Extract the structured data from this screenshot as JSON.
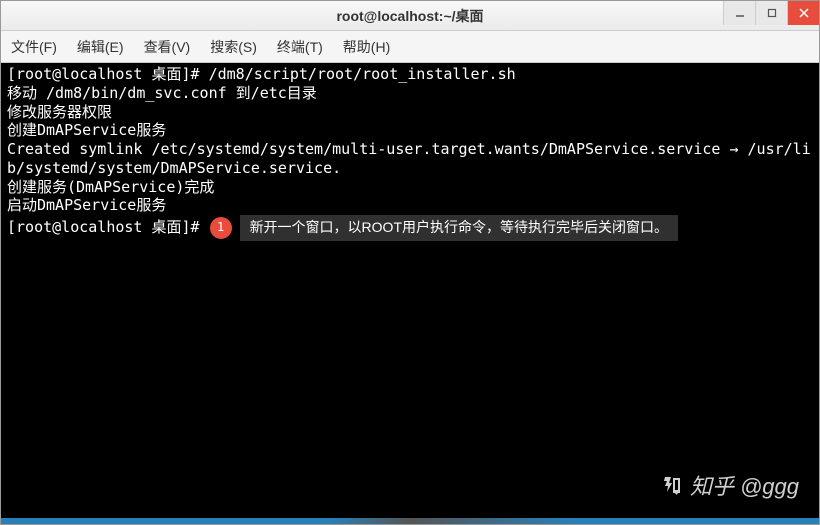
{
  "window": {
    "title": "root@localhost:~/桌面"
  },
  "menu": {
    "file": "文件(F)",
    "edit": "编辑(E)",
    "view": "查看(V)",
    "search": "搜索(S)",
    "terminal": "终端(T)",
    "help": "帮助(H)"
  },
  "terminal": {
    "prompt1": "[root@localhost 桌面]# ",
    "command1": "/dm8/script/root/root_installer.sh",
    "line2": "移动 /dm8/bin/dm_svc.conf 到/etc目录",
    "line3": "修改服务器权限",
    "line4": "创建DmAPService服务",
    "line5": "Created symlink /etc/systemd/system/multi-user.target.wants/DmAPService.service → /usr/lib/systemd/system/DmAPService.service.",
    "line6": "创建服务(DmAPService)完成",
    "line7": "启动DmAPService服务",
    "prompt2": "[root@localhost 桌面]# ",
    "badge_num": "1",
    "annotation": "新开一个窗口，以ROOT用户执行命令，等待执行完毕后关闭窗口。"
  },
  "watermark": {
    "brand": "知乎",
    "user": "@ggg"
  }
}
